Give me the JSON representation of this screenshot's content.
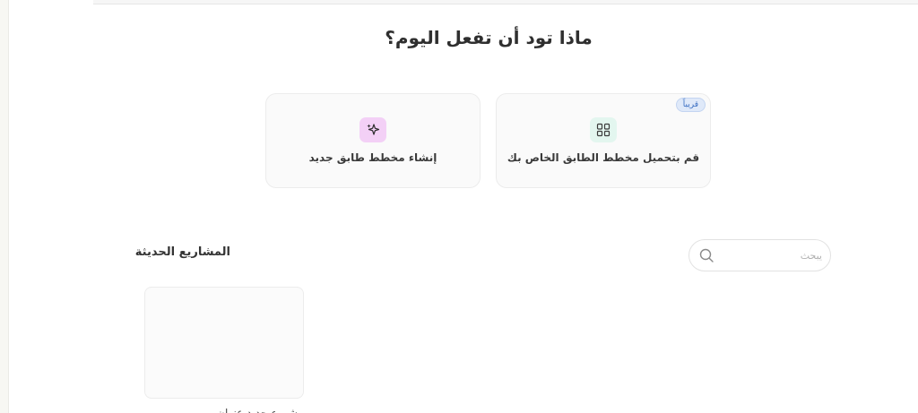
{
  "headline": "ماذا تود أن تفعل اليوم؟",
  "cards": {
    "new_plan": {
      "label": "إنشاء مخطط طابق جديد",
      "icon": "sparkles-icon",
      "icon_bg": "#f3d0f6"
    },
    "upload_plan": {
      "label": "قم بتحميل مخطط الطابق الخاص بك",
      "icon": "grid-layout-icon",
      "icon_bg": "#e3f6ef",
      "badge": "قريباً"
    }
  },
  "recent": {
    "title": "المشاريع الحديثة",
    "search": {
      "placeholder": "يبحث",
      "value": ""
    },
    "projects": [
      {
        "name": "مشروع جديد عنوان"
      }
    ]
  }
}
